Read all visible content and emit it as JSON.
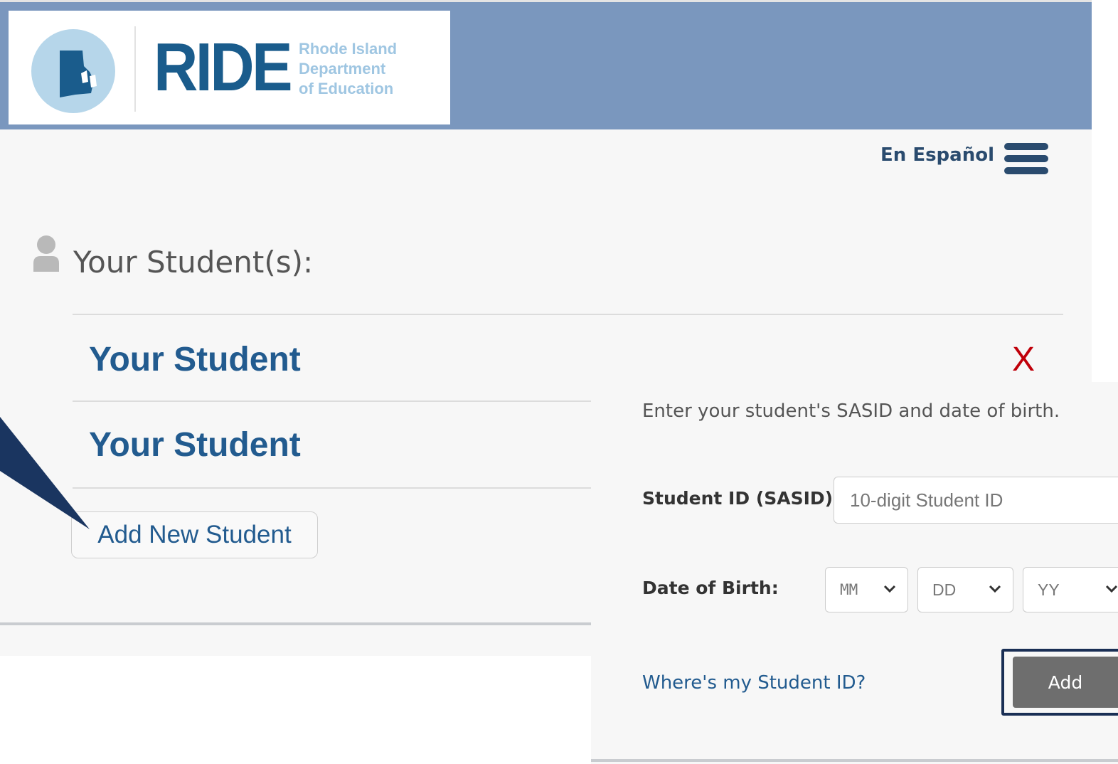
{
  "header": {
    "logo": {
      "wordmark": "RIDE",
      "subtitle": [
        "Rhode Island",
        "Department",
        "of Education"
      ]
    },
    "colors": {
      "banner": "#7a97be",
      "brand": "#1a5c8c",
      "brand_light": "#9fc6e2"
    }
  },
  "nav": {
    "language_link": "En Español",
    "menu_icon": "hamburger-menu-icon"
  },
  "students_section": {
    "title": "Your Student(s):",
    "students": [
      {
        "name": "Your Student"
      },
      {
        "name": "Your Student"
      }
    ],
    "remove_label": "X",
    "add_new_button": "Add New Student"
  },
  "add_student_form": {
    "instruction": "Enter your student's SASID and date of birth.",
    "sasid_label": "Student ID (SASID):",
    "sasid_placeholder": "10-digit Student ID",
    "sasid_value": "",
    "dob_label": "Date of Birth:",
    "dob_month": "MM",
    "dob_day": "DD",
    "dob_year": "YY",
    "help_link": "Where's my Student ID?",
    "submit_label": "Add"
  },
  "colors": {
    "link": "#225b8f",
    "remove": "#c0000a",
    "button_gray": "#6e6e6e",
    "focus_frame": "#1a2f55"
  }
}
